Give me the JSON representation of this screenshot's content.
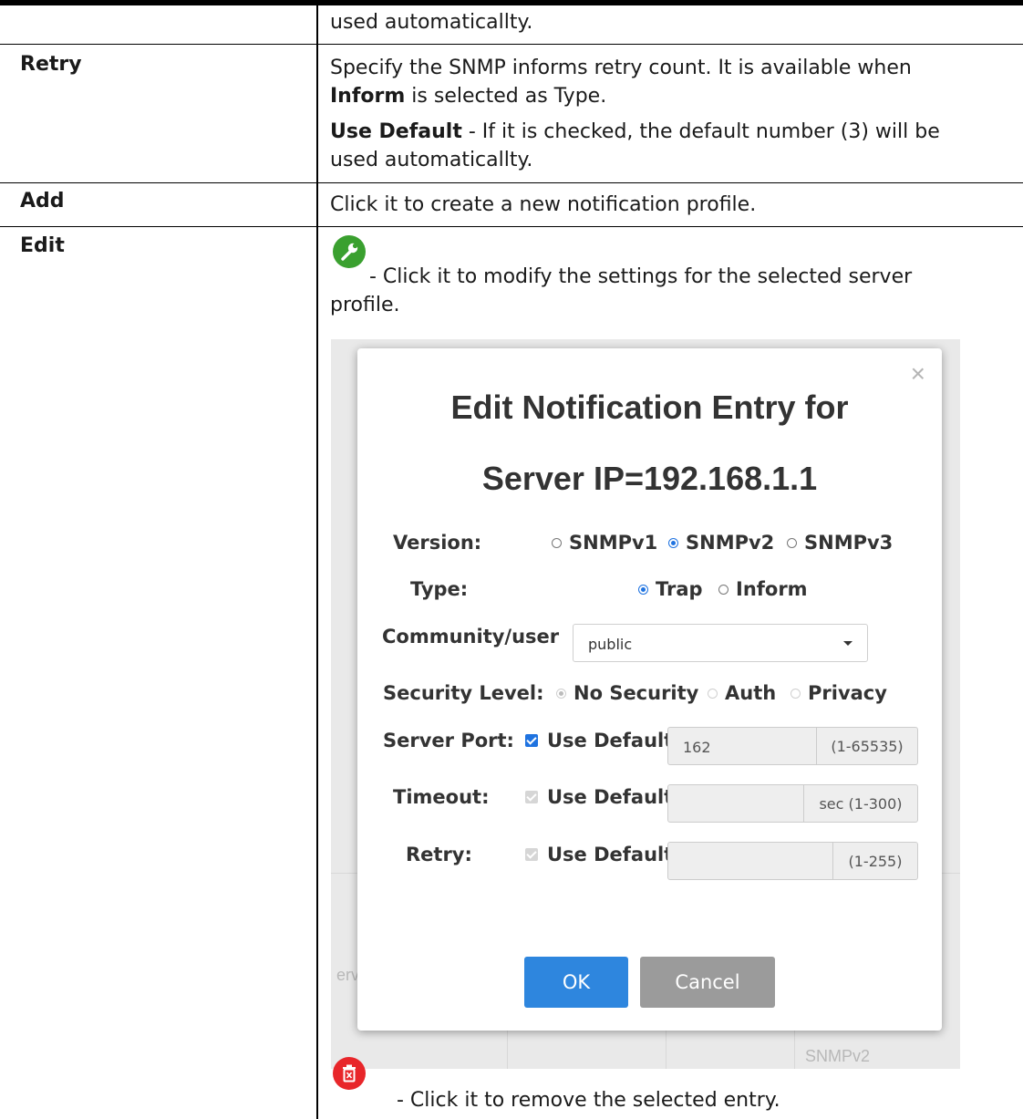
{
  "rows": {
    "row0": {
      "text": "used automaticallty."
    },
    "retry": {
      "label": "Retry",
      "line1": "Specify the SNMP informs retry count. It is available when",
      "line2_bold": "Inform",
      "line2_rest": " is selected as Type.",
      "line3_bold": "Use Default",
      "line3_rest": " - If it is checked, the default number (3) will be",
      "line4": "used automaticallty."
    },
    "add": {
      "label": "Add",
      "text": "Click it to create a new notification profile."
    },
    "edit": {
      "label": "Edit",
      "edit_line1": " - Click it to modify the settings for the selected server",
      "edit_line2": "profile.",
      "delete_line": "- Click it to remove the selected entry."
    }
  },
  "dialog": {
    "close": "×",
    "title_line1": "Edit Notification Entry for",
    "title_line2": "Server IP=192.168.1.1",
    "version_label": "Version:",
    "version_options": [
      "SNMPv1",
      "SNMPv2",
      "SNMPv3"
    ],
    "version_selected": "SNMPv2",
    "type_label": "Type:",
    "type_options": [
      "Trap",
      "Inform"
    ],
    "type_selected": "Trap",
    "community_label": "Community/user",
    "community_value": "public",
    "security_label": "Security Level:",
    "security_options": [
      "No Security",
      "Auth",
      "Privacy"
    ],
    "security_selected": "No Security",
    "server_port_label": "Server Port:",
    "server_port_checkbox": "Use Default",
    "server_port_value": "162",
    "server_port_range": "(1-65535)",
    "timeout_label": "Timeout:",
    "timeout_checkbox": "Use Default",
    "timeout_range": "sec (1-300)",
    "retry_label": "Retry:",
    "retry_checkbox": "Use Default",
    "retry_range": "(1-255)",
    "ok_label": "OK",
    "cancel_label": "Cancel"
  },
  "background_fragments": {
    "left": "erv",
    "right": "SNMPv2"
  },
  "colors": {
    "edit_icon": "#3aa02f",
    "delete_icon": "#e8262a",
    "primary": "#2e86de",
    "cancel": "#9b9b9b"
  }
}
